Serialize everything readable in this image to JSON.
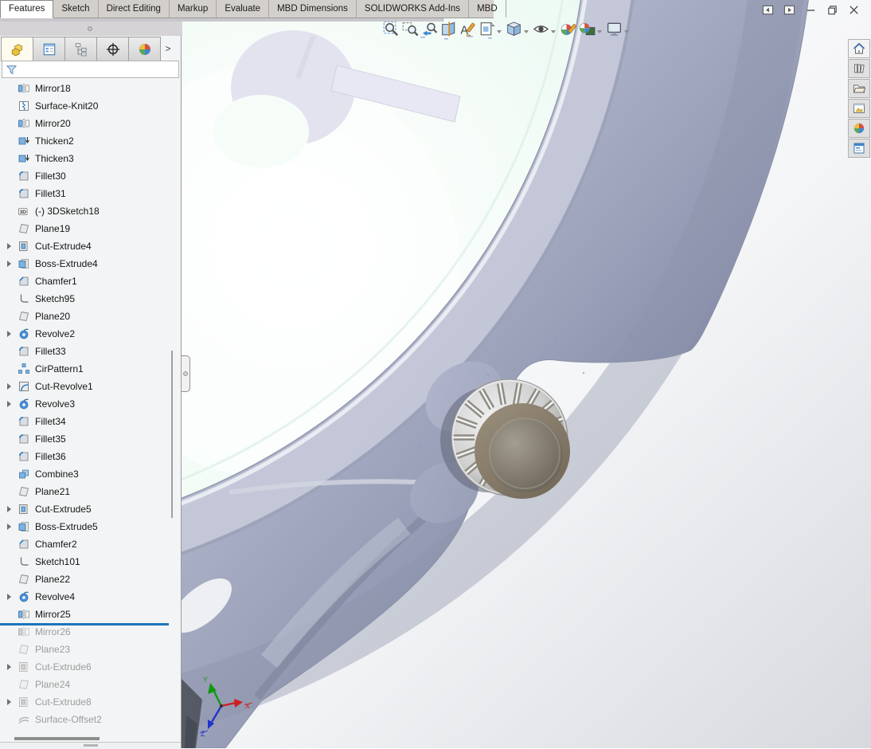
{
  "ribbon_tabs": [
    {
      "label": "Features",
      "active": true
    },
    {
      "label": "Sketch",
      "active": false
    },
    {
      "label": "Direct Editing",
      "active": false
    },
    {
      "label": "Markup",
      "active": false
    },
    {
      "label": "Evaluate",
      "active": false
    },
    {
      "label": "MBD Dimensions",
      "active": false
    },
    {
      "label": "SOLIDWORKS Add-Ins",
      "active": false
    },
    {
      "label": "MBD",
      "active": false
    }
  ],
  "heads_up_toolbar": {
    "items": [
      {
        "name": "zoom-to-fit-button",
        "icon": "hud-zoom-fit",
        "caret": false
      },
      {
        "name": "zoom-to-area-button",
        "icon": "hud-zoom-area",
        "caret": false
      },
      {
        "name": "previous-view-button",
        "icon": "hud-prev-view",
        "caret": false
      },
      {
        "name": "section-view-button",
        "icon": "hud-section",
        "caret": false
      },
      {
        "name": "dynamic-annotation-views-button",
        "icon": "hud-annot",
        "caret": false
      },
      {
        "name": "view-orientation-button",
        "icon": "hud-view-orient",
        "caret": true
      },
      {
        "name": "display-style-button",
        "icon": "hud-display-style",
        "caret": true
      },
      {
        "name": "hide-show-items-button",
        "icon": "hud-eye",
        "caret": true
      },
      {
        "name": "edit-appearance-button",
        "icon": "hud-appearance",
        "caret": false
      },
      {
        "name": "apply-scene-button",
        "icon": "hud-scene",
        "caret": true
      },
      {
        "name": "view-settings-button",
        "icon": "hud-monitor",
        "caret": true
      }
    ]
  },
  "window": {
    "controls": [
      {
        "name": "collapse-left-pane-button",
        "icon": "wc-pane-left"
      },
      {
        "name": "collapse-right-pane-button",
        "icon": "wc-pane-right"
      },
      {
        "name": "minimize-button",
        "icon": "wc-min"
      },
      {
        "name": "restore-button",
        "icon": "wc-restore"
      },
      {
        "name": "close-button",
        "icon": "wc-close"
      }
    ]
  },
  "feature_manager": {
    "pane_tabs": [
      {
        "name": "featuremanager-design-tree",
        "icon": "pt-part",
        "active": true
      },
      {
        "name": "property-manager",
        "icon": "pt-props",
        "active": false
      },
      {
        "name": "configuration-manager",
        "icon": "pt-config",
        "active": false
      },
      {
        "name": "dimxpertmanager",
        "icon": "pt-dimx",
        "active": false
      },
      {
        "name": "displaymanager",
        "icon": "pt-display",
        "active": false
      }
    ],
    "pane_tabs_expand_label": ">",
    "tree_items": [
      {
        "label": "Mirror18",
        "icon": "ic-mirror",
        "expandable": false,
        "grayed": false
      },
      {
        "label": "Surface-Knit20",
        "icon": "ic-surfknit",
        "expandable": false,
        "grayed": false
      },
      {
        "label": "Mirror20",
        "icon": "ic-mirror",
        "expandable": false,
        "grayed": false
      },
      {
        "label": "Thicken2",
        "icon": "ic-thicken",
        "expandable": false,
        "grayed": false
      },
      {
        "label": "Thicken3",
        "icon": "ic-thicken",
        "expandable": false,
        "grayed": false
      },
      {
        "label": "Fillet30",
        "icon": "ic-fillet",
        "expandable": false,
        "grayed": false
      },
      {
        "label": "Fillet31",
        "icon": "ic-fillet",
        "expandable": false,
        "grayed": false
      },
      {
        "label": "(-) 3DSketch18",
        "icon": "ic-sketch3d",
        "expandable": false,
        "grayed": false
      },
      {
        "label": "Plane19",
        "icon": "ic-plane",
        "expandable": false,
        "grayed": false
      },
      {
        "label": "Cut-Extrude4",
        "icon": "ic-cutextrude",
        "expandable": true,
        "grayed": false
      },
      {
        "label": "Boss-Extrude4",
        "icon": "ic-bossextrude",
        "expandable": true,
        "grayed": false
      },
      {
        "label": "Chamfer1",
        "icon": "ic-chamfer",
        "expandable": false,
        "grayed": false
      },
      {
        "label": "Sketch95",
        "icon": "ic-sketch",
        "expandable": false,
        "grayed": false
      },
      {
        "label": "Plane20",
        "icon": "ic-plane",
        "expandable": false,
        "grayed": false
      },
      {
        "label": "Revolve2",
        "icon": "ic-revolve",
        "expandable": true,
        "grayed": false
      },
      {
        "label": "Fillet33",
        "icon": "ic-fillet",
        "expandable": false,
        "grayed": false
      },
      {
        "label": "CirPattern1",
        "icon": "ic-cirpattern",
        "expandable": false,
        "grayed": false
      },
      {
        "label": "Cut-Revolve1",
        "icon": "ic-cutrevolve",
        "expandable": true,
        "grayed": false
      },
      {
        "label": "Revolve3",
        "icon": "ic-revolve",
        "expandable": true,
        "grayed": false
      },
      {
        "label": "Fillet34",
        "icon": "ic-fillet",
        "expandable": false,
        "grayed": false
      },
      {
        "label": "Fillet35",
        "icon": "ic-fillet",
        "expandable": false,
        "grayed": false
      },
      {
        "label": "Fillet36",
        "icon": "ic-fillet",
        "expandable": false,
        "grayed": false
      },
      {
        "label": "Combine3",
        "icon": "ic-combine",
        "expandable": false,
        "grayed": false
      },
      {
        "label": "Plane21",
        "icon": "ic-plane",
        "expandable": false,
        "grayed": false
      },
      {
        "label": "Cut-Extrude5",
        "icon": "ic-cutextrude",
        "expandable": true,
        "grayed": false
      },
      {
        "label": "Boss-Extrude5",
        "icon": "ic-bossextrude",
        "expandable": true,
        "grayed": false
      },
      {
        "label": "Chamfer2",
        "icon": "ic-chamfer",
        "expandable": false,
        "grayed": false
      },
      {
        "label": "Sketch101",
        "icon": "ic-sketch",
        "expandable": false,
        "grayed": false
      },
      {
        "label": "Plane22",
        "icon": "ic-plane",
        "expandable": false,
        "grayed": false
      },
      {
        "label": "Revolve4",
        "icon": "ic-revolve",
        "expandable": true,
        "grayed": false
      },
      {
        "label": "Mirror25",
        "icon": "ic-mirror",
        "expandable": false,
        "grayed": false,
        "rollback_bar_after": true
      },
      {
        "label": "Mirror26",
        "icon": "ic-mirror",
        "expandable": false,
        "grayed": true
      },
      {
        "label": "Plane23",
        "icon": "ic-plane",
        "expandable": false,
        "grayed": true
      },
      {
        "label": "Cut-Extrude6",
        "icon": "ic-cutextrude",
        "expandable": true,
        "grayed": true
      },
      {
        "label": "Plane24",
        "icon": "ic-plane",
        "expandable": false,
        "grayed": true
      },
      {
        "label": "Cut-Extrude8",
        "icon": "ic-cutextrude",
        "expandable": true,
        "grayed": true
      },
      {
        "label": "Surface-Offset2",
        "icon": "ic-surfoffset",
        "expandable": false,
        "grayed": true
      }
    ]
  },
  "task_pane": {
    "items": [
      {
        "name": "home-tab",
        "icon": "tp-home",
        "active": true
      },
      {
        "name": "design-library-tab",
        "icon": "tp-library",
        "active": false
      },
      {
        "name": "file-explorer-tab",
        "icon": "tp-folder",
        "active": false
      },
      {
        "name": "view-palette-tab",
        "icon": "tp-palette",
        "active": false
      },
      {
        "name": "appearances-scenes-tab",
        "icon": "tp-ball",
        "active": false
      },
      {
        "name": "custom-properties-tab",
        "icon": "tp-form",
        "active": false
      }
    ]
  },
  "viewport": {
    "triad": {
      "x_label": "X",
      "y_label": "Y",
      "z_label": "Z"
    },
    "colors": {
      "rollback_bar": "#1a75bb",
      "case": "#a9afc7",
      "glass": "#eaf8f1",
      "crown_ring": "#8a7d6c",
      "crown_cap": "#77705f",
      "knurl_silver": "#d2d2d2",
      "background_end": "#d7d9de"
    }
  }
}
